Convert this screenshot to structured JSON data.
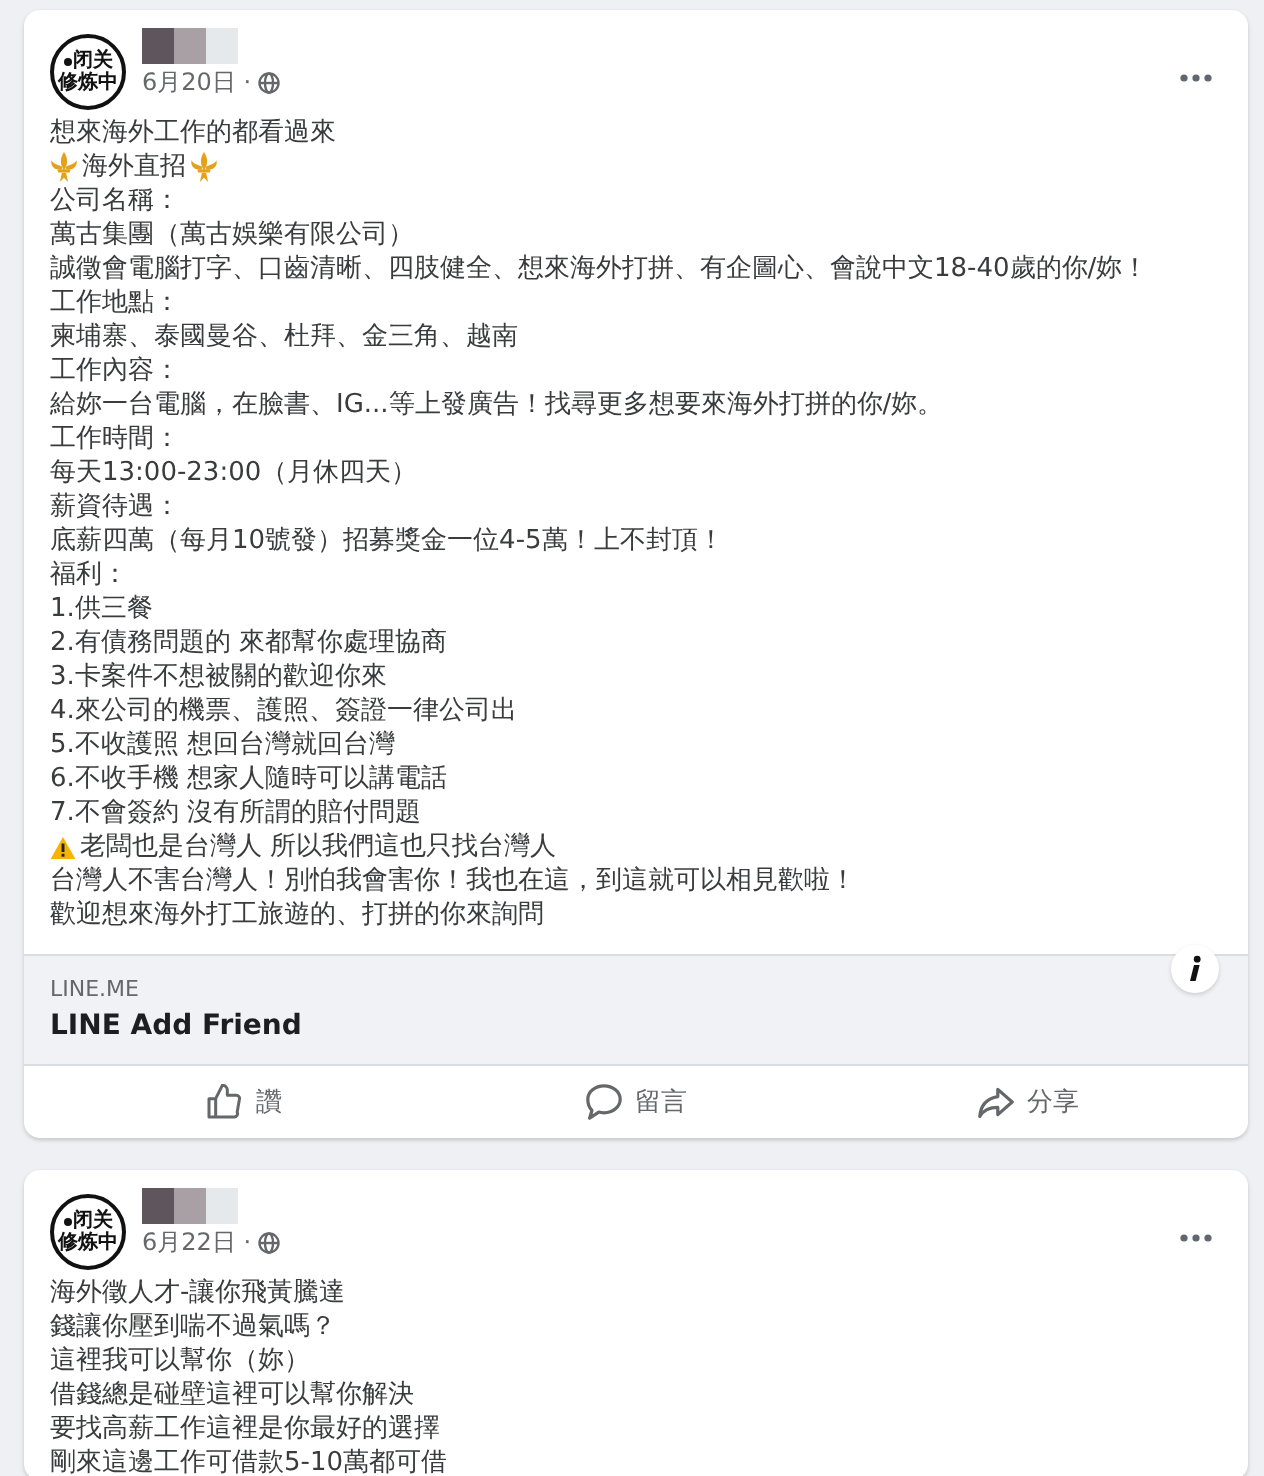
{
  "posts": [
    {
      "avatar": {
        "lines": [
          "闭关",
          "修炼中"
        ]
      },
      "date": "6月20日 ·",
      "lines": [
        {
          "kind": "plain",
          "text": "想來海外工作的都看過來"
        },
        {
          "kind": "flanked",
          "text": "海外直招"
        },
        {
          "kind": "plain",
          "text": "公司名稱："
        },
        {
          "kind": "plain",
          "text": "萬古集團（萬古娛樂有限公司）"
        },
        {
          "kind": "plain",
          "text": "誠徵會電腦打字、口齒清晰、四肢健全、想來海外打拼、有企圖心、會說中文18-40歲的你/妳！"
        },
        {
          "kind": "plain",
          "text": "工作地點："
        },
        {
          "kind": "plain",
          "text": "柬埔寨、泰國曼谷、杜拜、金三角、越南"
        },
        {
          "kind": "plain",
          "text": "工作內容："
        },
        {
          "kind": "plain",
          "text": "給妳一台電腦，在臉書、IG...等上發廣告！找尋更多想要來海外打拼的你/妳。"
        },
        {
          "kind": "plain",
          "text": "工作時間："
        },
        {
          "kind": "plain",
          "text": "每天13:00-23:00（月休四天）"
        },
        {
          "kind": "plain",
          "text": "薪資待遇："
        },
        {
          "kind": "plain",
          "text": "底薪四萬（每月10號發）招募獎金一位4-5萬！上不封頂！"
        },
        {
          "kind": "plain",
          "text": "福利："
        },
        {
          "kind": "plain",
          "text": "1.供三餐"
        },
        {
          "kind": "plain",
          "text": "2.有債務問題的 來都幫你處理協商"
        },
        {
          "kind": "plain",
          "text": "3.卡案件不想被關的歡迎你來"
        },
        {
          "kind": "plain",
          "text": "4.來公司的機票、護照、簽證一律公司出"
        },
        {
          "kind": "plain",
          "text": "5.不收護照 想回台灣就回台灣"
        },
        {
          "kind": "plain",
          "text": "6.不收手機 想家人隨時可以講電話"
        },
        {
          "kind": "plain",
          "text": "7.不會簽約 沒有所謂的賠付問題"
        },
        {
          "kind": "warning",
          "text": "老闆也是台灣人 所以我們這也只找台灣人"
        },
        {
          "kind": "plain",
          "text": "台灣人不害台灣人！別怕我會害你！我也在這，到這就可以相見歡啦！"
        },
        {
          "kind": "plain",
          "text": "歡迎想來海外打工旅遊的、打拼的你來詢問"
        }
      ],
      "link_preview": {
        "domain": "LINE.ME",
        "title": "LINE Add Friend"
      },
      "actions": [
        {
          "kind": "like",
          "label": "讚"
        },
        {
          "kind": "comment",
          "label": "留言"
        },
        {
          "kind": "share",
          "label": "分享"
        }
      ]
    },
    {
      "avatar": {
        "lines": [
          "闭关",
          "修炼中"
        ]
      },
      "date": "6月22日 ·",
      "lines": [
        {
          "kind": "plain",
          "text": "海外徵人才-讓你飛黃騰達"
        },
        {
          "kind": "plain",
          "text": "錢讓你壓到喘不過氣嗎？"
        },
        {
          "kind": "plain",
          "text": "這裡我可以幫你（妳）"
        },
        {
          "kind": "plain",
          "text": "借錢總是碰壁這裡可以幫你解決"
        },
        {
          "kind": "plain",
          "text": "要找高薪工作這裡是你最好的選擇"
        },
        {
          "kind": "plain",
          "text": "剛來這邊工作可借款5-10萬都可借"
        }
      ]
    }
  ]
}
